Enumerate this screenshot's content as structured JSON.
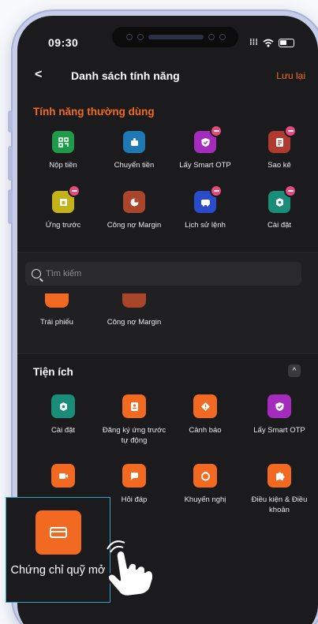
{
  "status": {
    "time": "09:30",
    "signal": "⁞⁞⁞"
  },
  "nav": {
    "back_glyph": "<",
    "title": "Danh sách tính năng",
    "save_label": "Lưu lại"
  },
  "frequent": {
    "title": "Tính năng thường dùng",
    "items": [
      {
        "label": "Nộp tiền",
        "icon": "qr-code-icon",
        "color": "#1f9a4a",
        "removable": false
      },
      {
        "label": "Chuyển tiền",
        "icon": "money-transfer-icon",
        "color": "#1d78b4",
        "removable": false
      },
      {
        "label": "Lấy Smart OTP",
        "icon": "shield-check-icon",
        "color": "#a32cbd",
        "removable": true
      },
      {
        "label": "Sao kê",
        "icon": "statement-icon",
        "color": "#b13a30",
        "removable": true
      },
      {
        "label": "Ứng trước",
        "icon": "advance-icon",
        "color": "#c4b21a",
        "removable": true
      },
      {
        "label": "Công nợ Margin",
        "icon": "pie-chart-icon",
        "color": "#a8452a",
        "removable": false
      },
      {
        "label": "Lịch sử lệnh",
        "icon": "history-icon",
        "color": "#2a4cc8",
        "removable": true
      },
      {
        "label": "Cài đặt",
        "icon": "settings-icon",
        "color": "#1a8c7a",
        "removable": true
      }
    ]
  },
  "search": {
    "placeholder": "Tìm kiếm"
  },
  "results": [
    {
      "label": "Trái phiếu",
      "color": "#f26a21"
    },
    {
      "label": "Công nợ Margin",
      "color": "#a8452a"
    }
  ],
  "utilities": {
    "title": "Tiện ích",
    "collapse_glyph": "^",
    "items": [
      {
        "label": "Cài đặt",
        "icon": "settings-icon",
        "color": "#1a8c7a"
      },
      {
        "label": "Đăng ký ứng trước tự động",
        "icon": "register-icon",
        "color": "#f26a21"
      },
      {
        "label": "Cảnh báo",
        "icon": "alert-icon",
        "color": "#f26a21"
      },
      {
        "label": "Lấy Smart OTP",
        "icon": "shield-check-icon",
        "color": "#a32cbd"
      },
      {
        "label": "",
        "icon": "video-icon",
        "color": "#f26a21"
      },
      {
        "label": "Hỏi đáp",
        "icon": "chat-icon",
        "color": "#f26a21"
      },
      {
        "label": "Khuyến nghị",
        "icon": "recommend-icon",
        "color": "#f26a21"
      },
      {
        "label": "Điều kiện & Điều khoản",
        "icon": "puzzle-icon",
        "color": "#f26a21"
      }
    ]
  },
  "callout": {
    "label": "Chứng chỉ quỹ mở",
    "icon": "card-icon",
    "color": "#f26a21"
  }
}
